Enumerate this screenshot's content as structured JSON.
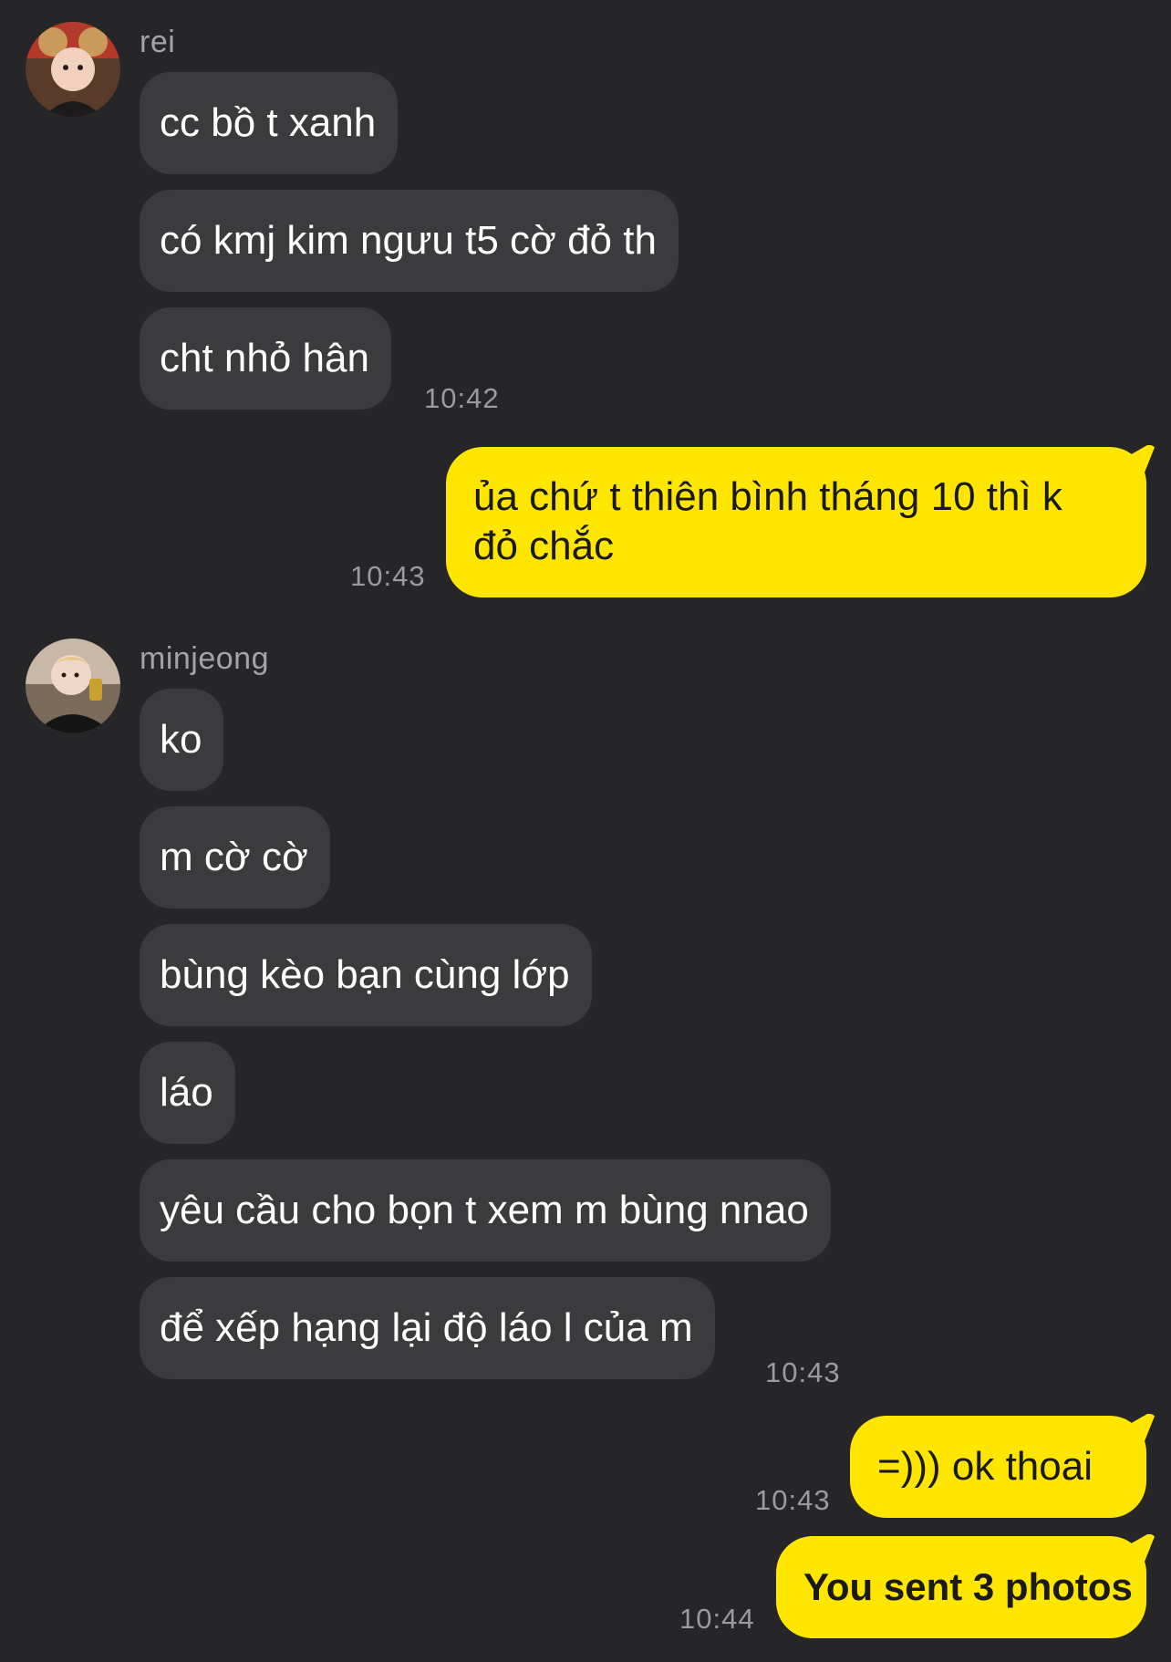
{
  "conversation": {
    "groups": [
      {
        "sender": "rei",
        "avatar_icon": "profile-photo-icon",
        "messages": [
          "cc bồ t xanh",
          "có kmj kim ngưu t5 cờ đỏ th",
          "cht nhỏ hân"
        ],
        "time": "10:42"
      },
      {
        "sender": "me",
        "messages": [
          "ủa chứ t thiên bình tháng 10 thì k",
          "đỏ chắc"
        ],
        "time": "10:43"
      },
      {
        "sender": "minjeong",
        "avatar_icon": "profile-photo-icon",
        "messages": [
          "ko",
          "m cờ cờ",
          "bùng kèo bạn cùng lớp",
          "láo",
          "yêu cầu cho bọn t xem m bùng nnao",
          "để xếp hạng lại độ láo l của m"
        ],
        "time": "10:43"
      },
      {
        "sender": "me",
        "messages": [
          "=))) ok thoai"
        ],
        "time": "10:43"
      },
      {
        "sender": "me",
        "messages": [
          "You sent 3 photos"
        ],
        "time": "10:44"
      }
    ]
  },
  "colors": {
    "background": "#262628",
    "incoming_bubble": "#3b3b3e",
    "outgoing_bubble": "#ffe600"
  }
}
